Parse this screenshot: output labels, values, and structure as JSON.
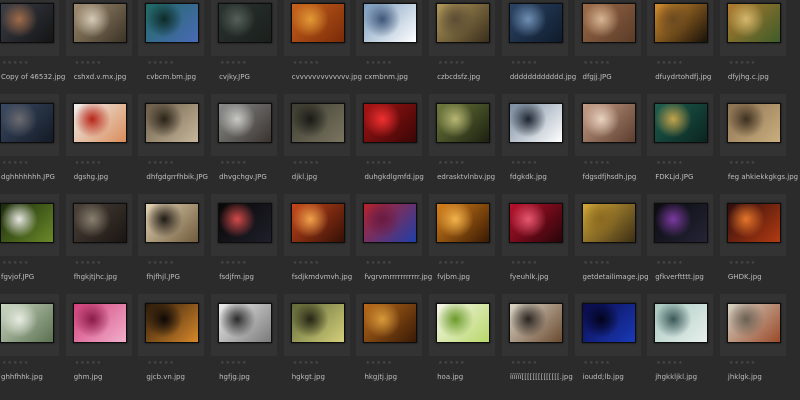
{
  "rows": [
    [
      {
        "name": "Copy of 46532.jpg",
        "colors": [
          "#3a3e48",
          "#141414",
          "#a06b4a"
        ],
        "shape": "rect"
      },
      {
        "name": "cshxd.v.mx.jpg",
        "colors": [
          "#a08c70",
          "#3b3326",
          "#d6cab6"
        ],
        "shape": "rect"
      },
      {
        "name": "cvbcm.bm.jpg",
        "colors": [
          "#1f6b63",
          "#4a6ab6",
          "#0e2b28"
        ],
        "shape": "rect"
      },
      {
        "name": "cvjky.JPG",
        "colors": [
          "#2a3330",
          "#1a1f1c",
          "#55605a"
        ],
        "shape": "rect"
      },
      {
        "name": "cvvvvvvvvvvvvv.jpg",
        "colors": [
          "#c7621c",
          "#7a2a08",
          "#e39a36"
        ],
        "shape": "rect"
      },
      {
        "name": "cxmbnm.jpg",
        "colors": [
          "#7a9bbd",
          "#ffffff",
          "#3e5578"
        ],
        "shape": "rect"
      },
      {
        "name": "czbcdsfz.jpg",
        "colors": [
          "#b0985a",
          "#3a2e1c",
          "#5b4c34"
        ],
        "shape": "rect"
      },
      {
        "name": "dddddddddddd.jpg",
        "colors": [
          "#2a4466",
          "#0f1b2b",
          "#6f8fb3"
        ],
        "shape": "rect"
      },
      {
        "name": "dfgjj.JPG",
        "colors": [
          "#9b6a48",
          "#5a3b28",
          "#d8b592"
        ],
        "shape": "rect"
      },
      {
        "name": "dfuydrtohdfj.jpg",
        "colors": [
          "#d38d2e",
          "#1a1209",
          "#6b4a20"
        ],
        "shape": "rect"
      },
      {
        "name": "dfyjhg.c.jpg",
        "colors": [
          "#b07a2c",
          "#3d5c2a",
          "#d6b76c"
        ],
        "shape": "rect"
      }
    ],
    [
      {
        "name": "dghhhhhhh.JPG",
        "colors": [
          "#394a63",
          "#141a25",
          "#6b6b70"
        ],
        "shape": "rect"
      },
      {
        "name": "dgshg.jpg",
        "colors": [
          "#f0f0ee",
          "#d98c5a",
          "#b82416"
        ],
        "shape": "rect"
      },
      {
        "name": "dhfgdgrrfhbik.JPG",
        "colors": [
          "#6a5c48",
          "#c8b79b",
          "#2a2318"
        ],
        "shape": "rect"
      },
      {
        "name": "dhvgchgv.JPG",
        "colors": [
          "#8a8c8a",
          "#3a3330",
          "#c8c8c4"
        ],
        "shape": "rect"
      },
      {
        "name": "djkl.jpg",
        "colors": [
          "#3c3c30",
          "#7a7560",
          "#1a1a16"
        ],
        "shape": "rect"
      },
      {
        "name": "duhgkdlgmfd.jpg",
        "colors": [
          "#a41414",
          "#3a0606",
          "#f03030"
        ],
        "shape": "rect"
      },
      {
        "name": "edrasktvlnbv.jpg",
        "colors": [
          "#6e7a3c",
          "#1c2010",
          "#b8b874"
        ],
        "shape": "rect"
      },
      {
        "name": "fdgkdk.jpg",
        "colors": [
          "#7a8ca0",
          "#ffffff",
          "#1c2430"
        ],
        "shape": "rect"
      },
      {
        "name": "fdgsdfjhsdh.jpg",
        "colors": [
          "#c59c86",
          "#5b3d2e",
          "#e9d2c0"
        ],
        "shape": "rect"
      },
      {
        "name": "FDKLjd.JPG",
        "colors": [
          "#1d5e50",
          "#0b241f",
          "#c4a44b"
        ],
        "shape": "rect"
      },
      {
        "name": "feg ahkiekkgkgs.jpg",
        "colors": [
          "#8c7252",
          "#c9ae7e",
          "#3d3020"
        ],
        "shape": "rect"
      }
    ],
    [
      {
        "name": "fgvjof.JPG",
        "colors": [
          "#1a2a0a",
          "#6a8a2a",
          "#e7e7e2"
        ],
        "shape": "rect"
      },
      {
        "name": "fhgkjtjhc.jpg",
        "colors": [
          "#4a4038",
          "#1b1613",
          "#8a8070"
        ],
        "shape": "rect"
      },
      {
        "name": "fhjfhjl.JPG",
        "colors": [
          "#e3d3b3",
          "#6e5a3c",
          "#1f1a14"
        ],
        "shape": "rect"
      },
      {
        "name": "fsdjfm.jpg",
        "colors": [
          "#070707",
          "#1f1f2a",
          "#d34a4a"
        ],
        "shape": "rect"
      },
      {
        "name": "fsdjkmdvmvh.jpg",
        "colors": [
          "#c6451b",
          "#341006",
          "#f2a14b"
        ],
        "shape": "rect"
      },
      {
        "name": "fvgrvmrrrrrrrrrrr.jpg",
        "colors": [
          "#b8222a",
          "#1f3fa8",
          "#6a1a40"
        ],
        "shape": "rect"
      },
      {
        "name": "fvjbm.jpg",
        "colors": [
          "#d7801a",
          "#3a1a03",
          "#f3b34b"
        ],
        "shape": "rect"
      },
      {
        "name": "fyeuhlk.jpg",
        "colors": [
          "#b8102a",
          "#280509",
          "#e85870"
        ],
        "shape": "rect"
      },
      {
        "name": "getdetailimage.jpg",
        "colors": [
          "#d3a838",
          "#3c2e15",
          "#8b6a20"
        ],
        "shape": "rect"
      },
      {
        "name": "gfkverftttt.jpg",
        "colors": [
          "#0b0b10",
          "#242435",
          "#7a3aa0"
        ],
        "shape": "rect"
      },
      {
        "name": "GHDK.jpg",
        "colors": [
          "#2e0d0d",
          "#b23a12",
          "#e6762a"
        ],
        "shape": "rect"
      }
    ],
    [
      {
        "name": "ghhfhhk.jpg",
        "colors": [
          "#c8d5c0",
          "#5a7050",
          "#e8ece2"
        ],
        "shape": "rect"
      },
      {
        "name": "ghm.jpg",
        "colors": [
          "#d0407a",
          "#f2b0cc",
          "#8a1a48"
        ],
        "shape": "rect"
      },
      {
        "name": "gjcb.vn.jpg",
        "colors": [
          "#2a1a0a",
          "#d8882a",
          "#0d0806"
        ],
        "shape": "rect"
      },
      {
        "name": "hgfjg.jpg",
        "colors": [
          "#ececec",
          "#7a7a7a",
          "#2a2a2a"
        ],
        "shape": "rect"
      },
      {
        "name": "hgkgt.jpg",
        "colors": [
          "#606838",
          "#d4d07a",
          "#242414"
        ],
        "shape": "rect"
      },
      {
        "name": "hkgjtj.jpg",
        "colors": [
          "#b86a1a",
          "#3a1a06",
          "#d89a3a"
        ],
        "shape": "rect"
      },
      {
        "name": "hoa.jpg",
        "colors": [
          "#f6f6ea",
          "#b8d86a",
          "#6a9a2a"
        ],
        "shape": "rect"
      },
      {
        "name": "ïïïïïï[[[[[[[[[[[[[[.jpg",
        "colors": [
          "#dcd6c8",
          "#6a4a30",
          "#2a2420"
        ],
        "shape": "rect"
      },
      {
        "name": "ioudd;lb.jpg",
        "colors": [
          "#0a0a4a",
          "#1a3ab8",
          "#03031a"
        ],
        "shape": "rect"
      },
      {
        "name": "jhgkkljkl.jpg",
        "colors": [
          "#a8c8c0",
          "#e8f0ec",
          "#3a5858"
        ],
        "shape": "rect"
      },
      {
        "name": "jhklgk.jpg",
        "colors": [
          "#d6d2c4",
          "#9a4a2a",
          "#6a6054"
        ],
        "shape": "rect"
      }
    ]
  ],
  "rating_stars": "★★★★★"
}
